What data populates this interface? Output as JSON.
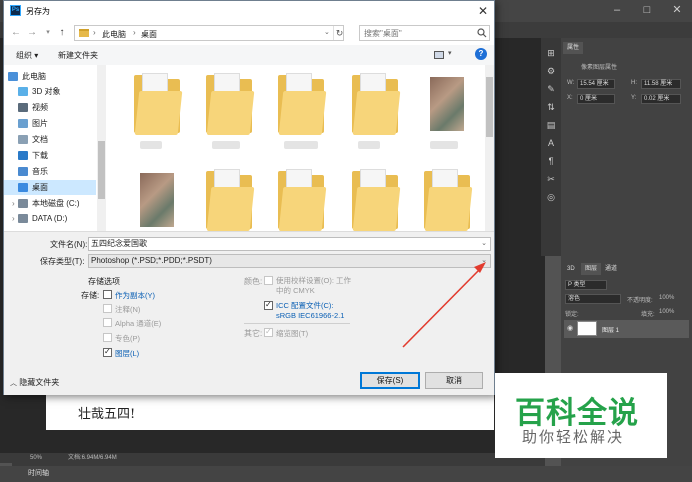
{
  "dialog": {
    "title": "另存为",
    "app_icon": "Ps",
    "close_glyph": "✕"
  },
  "address": {
    "crumbs": [
      "此电脑",
      "桌面"
    ],
    "search_placeholder": "搜索\"桌面\""
  },
  "toolbar": {
    "organize": "组织 ▾",
    "new_folder": "新建文件夹"
  },
  "nav": {
    "items": [
      {
        "label": "此电脑",
        "icon": "computer-icon",
        "color": "#4a90d9"
      },
      {
        "label": "3D 对象",
        "icon": "3d-objects-icon",
        "color": "#5ab0e8"
      },
      {
        "label": "视频",
        "icon": "video-icon",
        "color": "#5a6b7b"
      },
      {
        "label": "图片",
        "icon": "pictures-icon",
        "color": "#6aa0d0"
      },
      {
        "label": "文档",
        "icon": "documents-icon",
        "color": "#8aa0b4"
      },
      {
        "label": "下载",
        "icon": "downloads-icon",
        "color": "#2a7ac8"
      },
      {
        "label": "音乐",
        "icon": "music-icon",
        "color": "#4a8ad0"
      },
      {
        "label": "桌面",
        "icon": "desktop-icon",
        "color": "#3a8ae0"
      },
      {
        "label": "本地磁盘 (C:)",
        "icon": "drive-icon",
        "color": "#7a8a9a"
      },
      {
        "label": "DATA (D:)",
        "icon": "drive-icon",
        "color": "#7a8a9a"
      }
    ]
  },
  "form": {
    "filename_label": "文件名(N):",
    "filename_value": "五四纪念爱国歌",
    "filetype_label": "保存类型(T):",
    "filetype_value": "Photoshop (*.PSD;*.PDD;*.PSDT)",
    "save_options_title": "存储选项",
    "save_label": "存储:",
    "as_copy": "作为副本(Y)",
    "notes": "注释(N)",
    "alpha": "Alpha 通道(E)",
    "spot": "专色(P)",
    "layers": "图层(L)",
    "color_label": "颜色:",
    "use_proof": "使用校样设置(O): 工作中的 CMYK",
    "icc_line1": "ICC 配置文件(C):",
    "icc_line2": "sRGB IEC61966-2.1",
    "other_label": "其它:",
    "thumbnail": "缩览图(T)",
    "save_button": "保存(S)",
    "cancel_button": "取消",
    "hide_folders": "隐藏文件夹"
  },
  "photoshop": {
    "doc_text": "壮哉五四!",
    "zoom": "50%",
    "doc_info": "文档:6.94M/6.94M",
    "timeline": "时间轴",
    "panel_title": "属性",
    "panel_sub": "像素图层属性",
    "w_label": "W:",
    "w_value": "15.54 厘米",
    "h_label": "H:",
    "h_value": "11.58 厘米",
    "x_label": "X:",
    "x_value": "0 厘米",
    "y_label": "Y:",
    "y_value": "0.02 厘米",
    "tab_3d": "3D",
    "tab_layers": "图层",
    "tab_channels": "通道",
    "kind": "P 类型",
    "blend": "溶色",
    "opacity_label": "不透明度:",
    "opacity_value": "100%",
    "lock_label": "锁定:",
    "fill_label": "填充:",
    "fill_value": "100%",
    "layer_name": "图层 1"
  },
  "watermark": {
    "title": "百科全说",
    "subtitle": "助你轻松解决"
  },
  "colors": {
    "accent": "#0078d7",
    "annotation_arrow": "#e23b2e",
    "watermark_green": "#25a24a"
  }
}
